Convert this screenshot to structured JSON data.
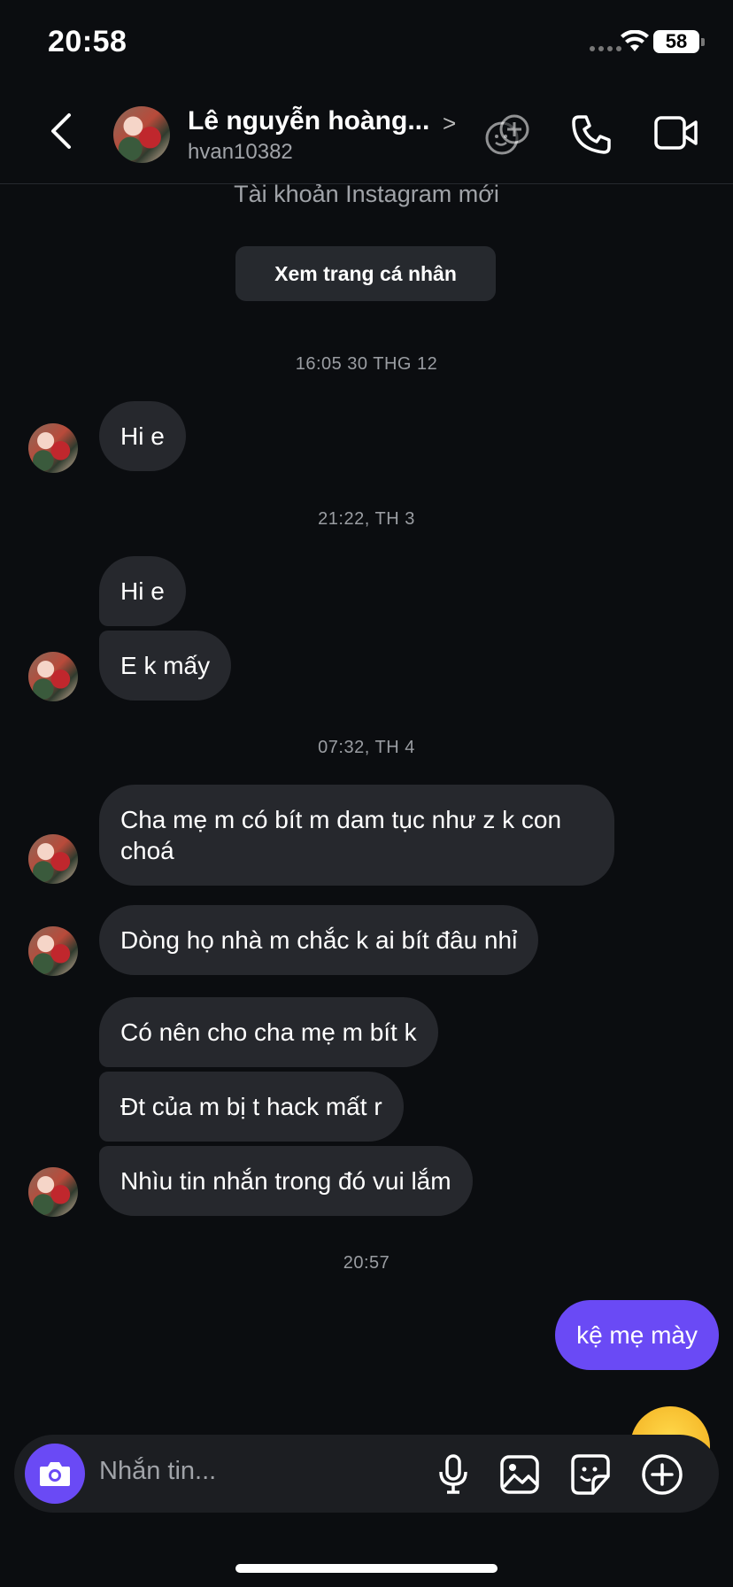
{
  "status_bar": {
    "time": "20:58",
    "battery": "58"
  },
  "header": {
    "name": "Lê nguyễn hoàng...",
    "handle": "hvan10382"
  },
  "notice": "Tài khoản Instagram mới",
  "profile_button": "Xem trang cá nhân",
  "timestamps": [
    "16:05 30 THG 12",
    "21:22, TH 3",
    "07:32, TH 4",
    "20:57"
  ],
  "messages": [
    {
      "text": "Hi e",
      "from": "other"
    },
    {
      "text": "Hi e",
      "from": "other"
    },
    {
      "text": "E k mấy",
      "from": "other"
    },
    {
      "text": "Cha mẹ m có bít m dam tục như z k con choá",
      "from": "other"
    },
    {
      "text": "Dòng họ nhà m chắc k ai bít đâu nhỉ",
      "from": "other"
    },
    {
      "text": "Có nên cho cha mẹ m bít k",
      "from": "other"
    },
    {
      "text": "Đt của m bị t hack mất r",
      "from": "other"
    },
    {
      "text": "Nhìu tin nhắn trong đó vui lắm",
      "from": "other"
    },
    {
      "text": "kệ mẹ mày",
      "from": "me"
    }
  ],
  "composer": {
    "placeholder": "Nhắn tin..."
  },
  "colors": {
    "accent": "#6a4af5",
    "bubble": "#26282d",
    "background": "#0b0d10"
  }
}
